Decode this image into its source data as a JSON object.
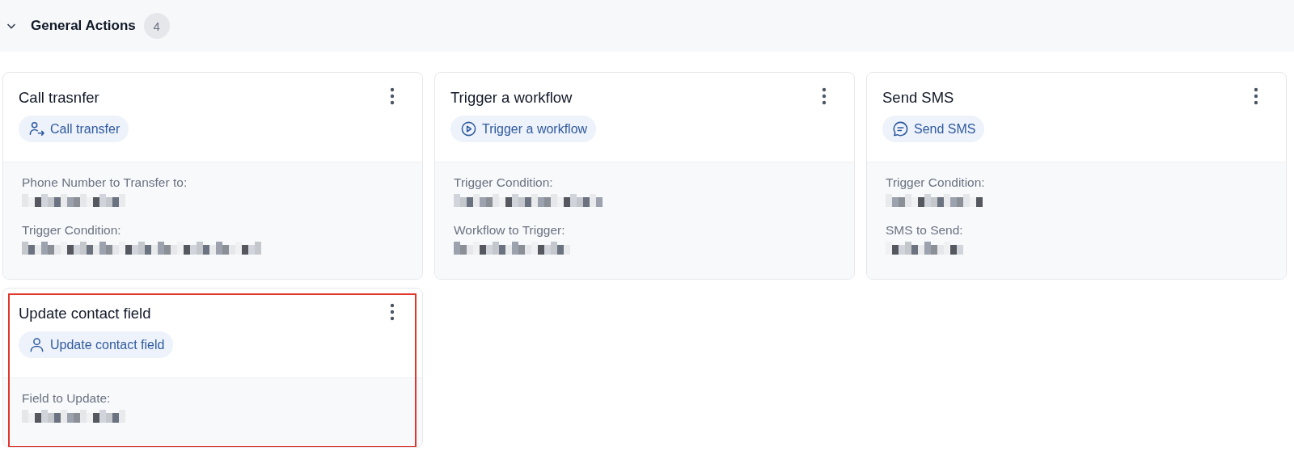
{
  "section": {
    "title": "General Actions",
    "count": "4",
    "expanded": true
  },
  "cards": [
    {
      "title": "Call trasnfer",
      "kind": "call_transfer",
      "badge": "Call transfer",
      "highlighted": false,
      "fields": [
        {
          "label": "Phone Number to Transfer to:",
          "redacted": true
        },
        {
          "label": "Trigger Condition:",
          "redacted": true
        }
      ]
    },
    {
      "title": "Trigger a workflow",
      "kind": "workflow",
      "badge": "Trigger a workflow",
      "highlighted": false,
      "fields": [
        {
          "label": "Trigger Condition:",
          "redacted": true
        },
        {
          "label": "Workflow to Trigger:",
          "redacted": true
        }
      ]
    },
    {
      "title": "Send SMS",
      "kind": "sms",
      "badge": "Send SMS",
      "highlighted": false,
      "fields": [
        {
          "label": "Trigger Condition:",
          "redacted": true
        },
        {
          "label": "SMS to Send:",
          "redacted": true
        }
      ]
    },
    {
      "title": "Update contact field",
      "kind": "contact",
      "badge": "Update contact field",
      "highlighted": true,
      "fields": [
        {
          "label": "Field to Update:",
          "redacted": true
        }
      ]
    }
  ]
}
